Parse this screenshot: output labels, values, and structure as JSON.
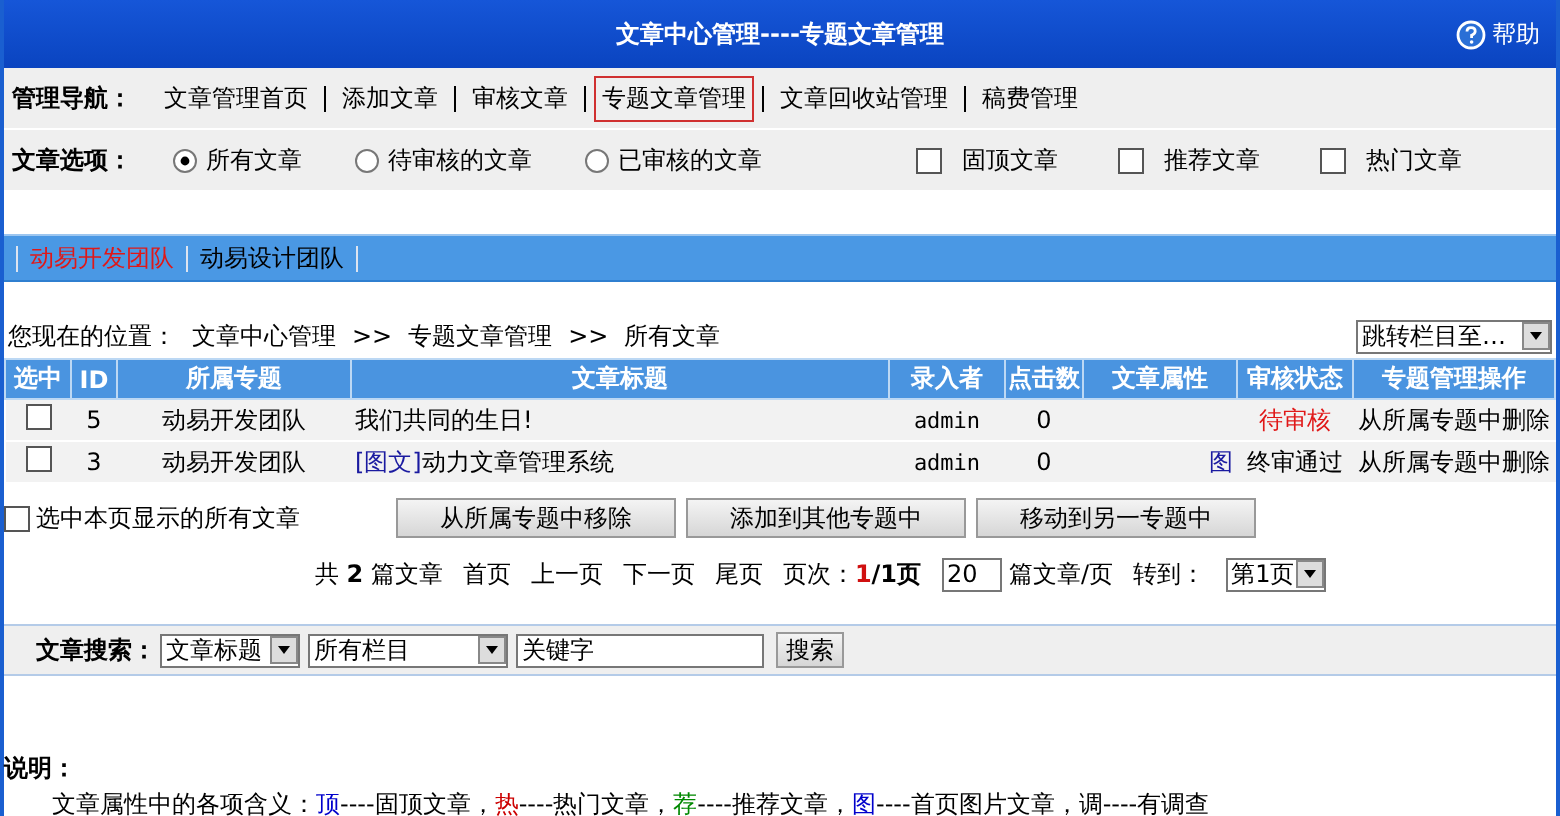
{
  "header": {
    "title": "文章中心管理----专题文章管理",
    "help": "帮助"
  },
  "nav": {
    "label": "管理导航：",
    "items": [
      {
        "label": "文章管理首页",
        "selected": false
      },
      {
        "label": "添加文章",
        "selected": false
      },
      {
        "label": "审核文章",
        "selected": false
      },
      {
        "label": "专题文章管理",
        "selected": true
      },
      {
        "label": "文章回收站管理",
        "selected": false
      },
      {
        "label": "稿费管理",
        "selected": false
      }
    ]
  },
  "options": {
    "label": "文章选项：",
    "radios": [
      {
        "label": "所有文章",
        "selected": true
      },
      {
        "label": "待审核的文章",
        "selected": false
      },
      {
        "label": "已审核的文章",
        "selected": false
      }
    ],
    "checkboxes": [
      {
        "label": "固顶文章",
        "checked": false
      },
      {
        "label": "推荐文章",
        "checked": false
      },
      {
        "label": "热门文章",
        "checked": false
      }
    ]
  },
  "teams": [
    {
      "label": "动易开发团队",
      "selected": true
    },
    {
      "label": "动易设计团队",
      "selected": false
    }
  ],
  "breadcrumb": {
    "label": "您现在的位置：",
    "items": [
      "文章中心管理",
      ">>",
      "专题文章管理",
      ">>",
      "所有文章"
    ]
  },
  "jump_select": {
    "value": "跳转栏目至…"
  },
  "table": {
    "columns": [
      "选中",
      "ID",
      "所属专题",
      "文章标题",
      "录入者",
      "点击数",
      "文章属性",
      "审核状态",
      "专题管理操作"
    ],
    "rows": [
      {
        "checked": false,
        "id": "5",
        "topic": "动易开发团队",
        "title": "我们共同的生日!",
        "author": "admin",
        "hits": "0",
        "attribute": "",
        "status": "待审核",
        "pending": true,
        "action": "从所属专题中删除"
      },
      {
        "checked": false,
        "id": "3",
        "topic": "动易开发团队",
        "tag": "[图文]",
        "title": "动力文章管理系统",
        "author": "admin",
        "hits": "0",
        "attribute": "图",
        "status": "终审通过",
        "pending": false,
        "action": "从所属专题中删除"
      }
    ]
  },
  "select_all": {
    "label": "选中本页显示的所有文章",
    "checked": false
  },
  "buttons": [
    "从所属专题中移除",
    "添加到其他专题中",
    "移动到另一专题中"
  ],
  "pagination": {
    "total_prefix": "共",
    "total": "2",
    "total_suffix": "篇文章",
    "first": "首页",
    "prev": "上一页",
    "next": "下一页",
    "last": "尾页",
    "page_label": "页次：",
    "current": "1",
    "pages": "/1页",
    "per_page": "20",
    "per_page_suffix": "篇文章/页",
    "goto_label": "转到：",
    "goto_value": "第1页"
  },
  "search": {
    "label": "文章搜索：",
    "field_select": "文章标题",
    "category_select": "所有栏目",
    "keyword": "关键字",
    "button": "搜索"
  },
  "notes": {
    "title": "说明：",
    "prefix": "文章属性中的各项含义：",
    "legend": [
      {
        "symbol": "顶",
        "color": "#0000cc",
        "meaning": "----固顶文章，"
      },
      {
        "symbol": "热",
        "color": "#cc0000",
        "meaning": "----热门文章，"
      },
      {
        "symbol": "荐",
        "color": "#008800",
        "meaning": "----推荐文章，"
      },
      {
        "symbol": "图",
        "color": "#0000cc",
        "meaning": "----首页图片文章，"
      },
      {
        "symbol": "调",
        "color": "#000000",
        "meaning": "----有调查"
      }
    ]
  }
}
